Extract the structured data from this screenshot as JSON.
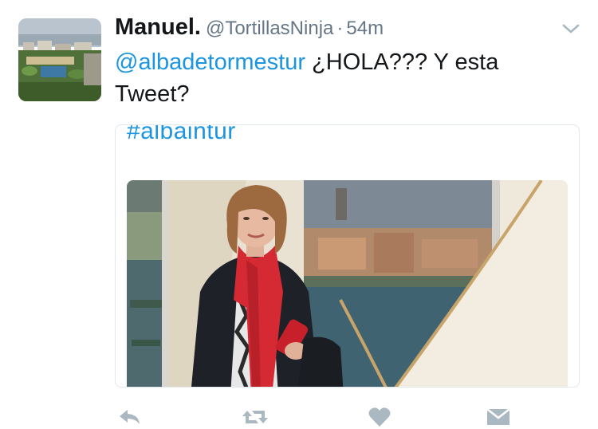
{
  "tweet": {
    "display_name": "Manuel.",
    "handle": "@TortillasNinja",
    "separator": "·",
    "time": "54m",
    "mention": "@albadetormestur",
    "text": " ¿HOLA???  Y esta Tweet?"
  },
  "card": {
    "hashtag": "#albaintur"
  },
  "icons": {
    "reply": "reply-icon",
    "retweet": "retweet-icon",
    "like": "heart-icon",
    "dm": "envelope-icon",
    "menu": "chevron-down-icon"
  },
  "colors": {
    "link": "#1b95e0",
    "secondary_text": "#657786",
    "action_icons": "#aab8c2",
    "scarf": "#d52a34"
  }
}
